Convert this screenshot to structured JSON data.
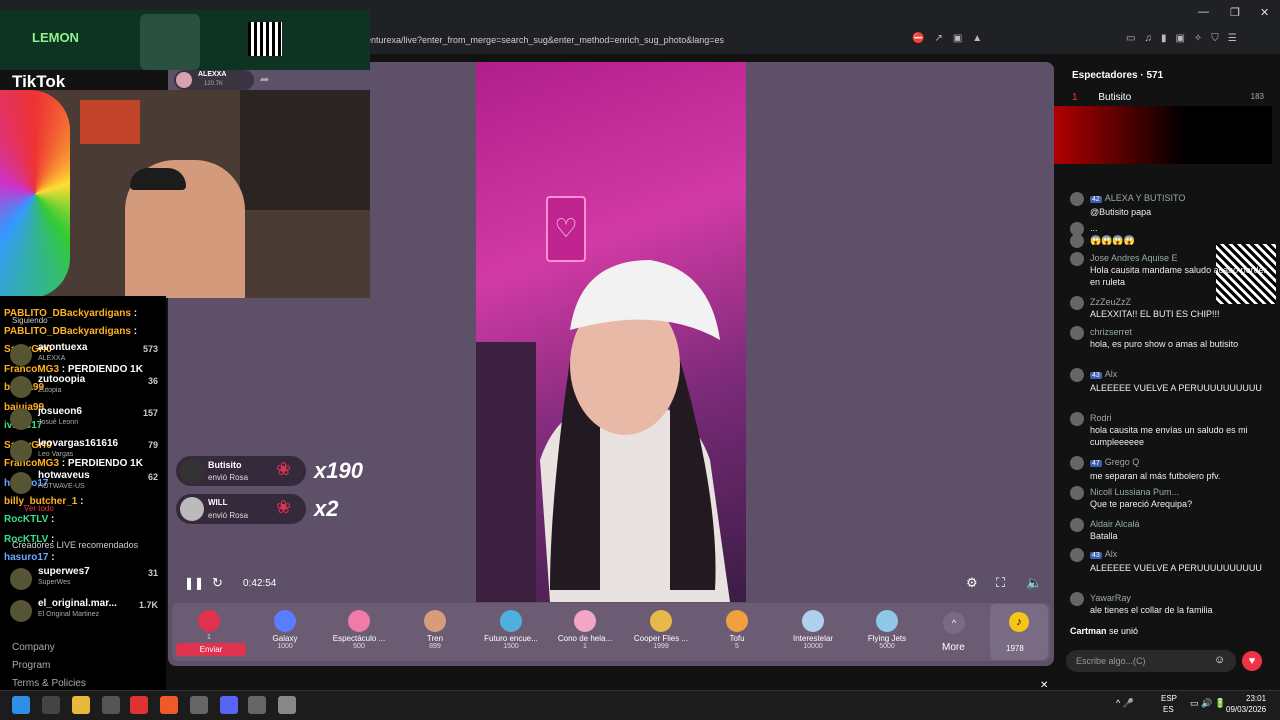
{
  "browser": {
    "url": "enturexa/live?enter_from_merge=search_sug&enter_method=enrich_sug_photo&lang=es"
  },
  "overlay": {
    "sponsor": "LEMON",
    "brand": "TikTok"
  },
  "host": {
    "name": "ALEXXA",
    "followers": "120.7K"
  },
  "left_chat": [
    {
      "name": "PABLITO_DBackyardigans",
      "msg": ":",
      "color": "orange"
    },
    {
      "name": "PABLITO_DBackyardigans",
      "msg": ":",
      "color": "orange"
    },
    {
      "name": "SantyGrf0",
      "msg": "",
      "color": "orange"
    },
    {
      "name": "FrancoMG3",
      "msg": ": PERDIENDO 1K",
      "color": "orange"
    },
    {
      "name": "baiuja99",
      "msg": "",
      "color": "orange"
    },
    {
      "name": "baiuja99",
      "msg": "",
      "color": "orange"
    },
    {
      "name": "ivanC17",
      "msg": "",
      "color": "green"
    },
    {
      "name": "SantyGrf0",
      "msg": "",
      "color": "orange"
    },
    {
      "name": "FrancoMG3",
      "msg": ": PERDIENDO 1K",
      "color": "orange"
    },
    {
      "name": "hasuro17",
      "msg": "",
      "color": "blue"
    },
    {
      "name": "billy_butcher_1",
      "msg": ":",
      "color": "orange"
    },
    {
      "name": "RocKTLV",
      "msg": ":",
      "color": "green"
    },
    {
      "name": "RocKTLV",
      "msg": ":",
      "color": "green"
    },
    {
      "name": "hasuro17",
      "msg": ":",
      "color": "blue"
    }
  ],
  "viewer_list": [
    {
      "name": "avontuexa",
      "sub": "ALEXXA",
      "count": "573"
    },
    {
      "name": "zutooopia",
      "sub": "Zutopia",
      "count": "36"
    },
    {
      "name": "josueon6",
      "sub": "Josué Leonn",
      "count": "157"
    },
    {
      "name": "leovargas161616",
      "sub": "Leo Vargas",
      "count": "79"
    },
    {
      "name": "hotwaveus",
      "sub": "HOTWAVE-US",
      "count": "62"
    },
    {
      "name": "superwes7",
      "sub": "SuperWes",
      "count": "31"
    },
    {
      "name": "el_original.mar...",
      "sub": "El Original Martinez",
      "count": "1.7K"
    }
  ],
  "left_labels": {
    "following": "Siguiendo",
    "see_all": "Ver todo",
    "recommended": "Creadores LIVE recomendados"
  },
  "footer": {
    "company": "Company",
    "program": "Program",
    "terms": "Terms & Policies"
  },
  "gift_alerts": [
    {
      "user": "Butisito",
      "action": "envió Rosa",
      "count": "x190"
    },
    {
      "user": "WILL",
      "action": "envió Rosa",
      "count": "x2"
    }
  ],
  "player": {
    "time": "0:42:54"
  },
  "gifts": [
    {
      "name": "",
      "price": "1",
      "send": "Enviar",
      "color": "#e0324f"
    },
    {
      "name": "Galaxy",
      "price": "1000",
      "color": "#5a7cff"
    },
    {
      "name": "Espectáculo ...",
      "price": "500",
      "color": "#f07aa8"
    },
    {
      "name": "Tren",
      "price": "899",
      "color": "#d79c7a"
    },
    {
      "name": "Futuro encue...",
      "price": "1500",
      "color": "#4fb0e0"
    },
    {
      "name": "Cono de hela...",
      "price": "1",
      "color": "#f2a5c5"
    },
    {
      "name": "Cooper Flies ...",
      "price": "1999",
      "color": "#e8b84a"
    },
    {
      "name": "Tofu",
      "price": "5",
      "color": "#f0a040"
    },
    {
      "name": "Interestelar",
      "price": "10000",
      "color": "#b0d0f0"
    },
    {
      "name": "Flying Jets",
      "price": "5000",
      "color": "#90c8e8"
    }
  ],
  "gift_more": "More",
  "coins": "1978",
  "right": {
    "viewers_label": "Espectadores · 571",
    "top_viewer": {
      "rank": "1",
      "name": "Butisito",
      "score": "183"
    },
    "chat": [
      {
        "name": "ALEXA Y BUTISITO",
        "badge": "42",
        "msg": "@Butisito papa"
      },
      {
        "name": "",
        "badge": "",
        "msg": "..."
      },
      {
        "name": "",
        "badge": "",
        "msg": "😱😱😱😱"
      },
      {
        "name": "Jose Andres Aquise E",
        "badge": "",
        "msg": "Hola causita mandame saludo acabo perder en ruleta"
      },
      {
        "name": "ZzZeuZzZ",
        "badge": "",
        "msg": "ALEXXITA!! EL BUTI ES CHIP!!!"
      },
      {
        "name": "chrizserret",
        "badge": "",
        "msg": "hola, es puro show o amas al butisito"
      },
      {
        "name": "Alx",
        "badge": "43",
        "msg": "ALEEEEE VUELVE A PERUUUUUUUUUU"
      },
      {
        "name": "Rodri",
        "badge": "",
        "msg": "hola causita me envías un saludo es mi cumpleeeeee"
      },
      {
        "name": "Grego Q",
        "badge": "47",
        "msg": "me separan al más futbolero pfv."
      },
      {
        "name": "Nicoll Lussiana Pum...",
        "badge": "",
        "msg": "Que te pareció Arequipa?"
      },
      {
        "name": "Aldair Alcalá",
        "badge": "",
        "msg": "Batalla"
      },
      {
        "name": "Alx",
        "badge": "43",
        "msg": "ALEEEEE VUELVE A PERUUUUUUUUUU"
      },
      {
        "name": "YawarRay",
        "badge": "",
        "msg": "ale tienes el collar de la familia"
      }
    ],
    "join": {
      "name": "Cartman",
      "msg": "se unió"
    },
    "input_placeholder": "Escribe algo...(C)"
  },
  "taskbar": {
    "lang1": "ESP",
    "lang2": "ES",
    "time": "23:01",
    "date": "09/03/2026"
  }
}
